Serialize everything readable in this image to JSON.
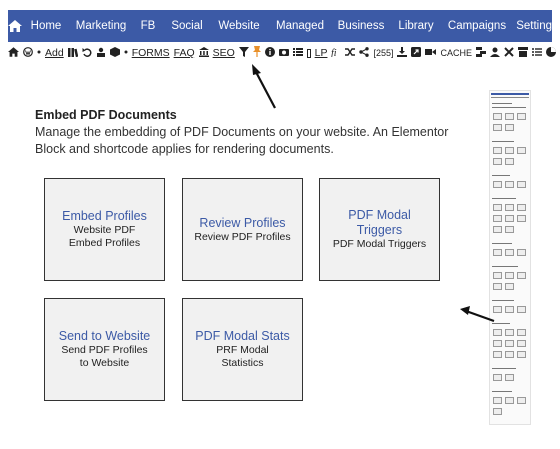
{
  "nav": {
    "items": [
      {
        "label": "Home"
      },
      {
        "label": "Marketing"
      },
      {
        "label": "FB"
      },
      {
        "label": "Social"
      },
      {
        "label": "Website"
      },
      {
        "label": "Managed"
      },
      {
        "label": "Business"
      },
      {
        "label": "Library"
      },
      {
        "label": "Campaigns"
      },
      {
        "label": "Settings"
      }
    ],
    "background": "#3c5aa6"
  },
  "toolbar": {
    "add": "Add",
    "forms": "FORMS",
    "faq": "FAQ",
    "seo": "SEO",
    "lp": "LP",
    "count": "[255]",
    "cache": "CACHE"
  },
  "page": {
    "title": "Embed PDF Documents",
    "description": "Manage the embedding of PDF Documents on your website. An Elementor Block and shortcode applies for rendering documents."
  },
  "cards": [
    {
      "title": "Embed Profiles",
      "desc": "Website PDF Embed Profiles"
    },
    {
      "title": "Review Profiles",
      "desc": "Review PDF Profiles"
    },
    {
      "title": "PDF Modal Triggers",
      "desc": "PDF Modal Triggers"
    },
    {
      "title": "Send to Website",
      "desc": "Send PDF Profiles to Website"
    },
    {
      "title": "PDF Modal Stats",
      "desc": "PRF Modal Statistics"
    }
  ],
  "colors": {
    "accent": "#3c5aa6",
    "card_bg": "#f1f1f1",
    "pin_icon": "#e8902a"
  },
  "icons": [
    "home-icon",
    "wordpress-icon",
    "dot-icon",
    "library-icon",
    "undo-icon",
    "user-group-icon",
    "cube-icon",
    "bank-icon",
    "filter-icon",
    "pin-icon",
    "info-icon",
    "camera-icon",
    "list-icon",
    "square-icon",
    "fi-icon",
    "shuffle-icon",
    "share-icon",
    "download-icon",
    "external-icon",
    "video-icon",
    "sitemap-icon",
    "user-icon",
    "tools-icon",
    "archive-icon",
    "menu-list-icon",
    "pie-chart-icon"
  ]
}
